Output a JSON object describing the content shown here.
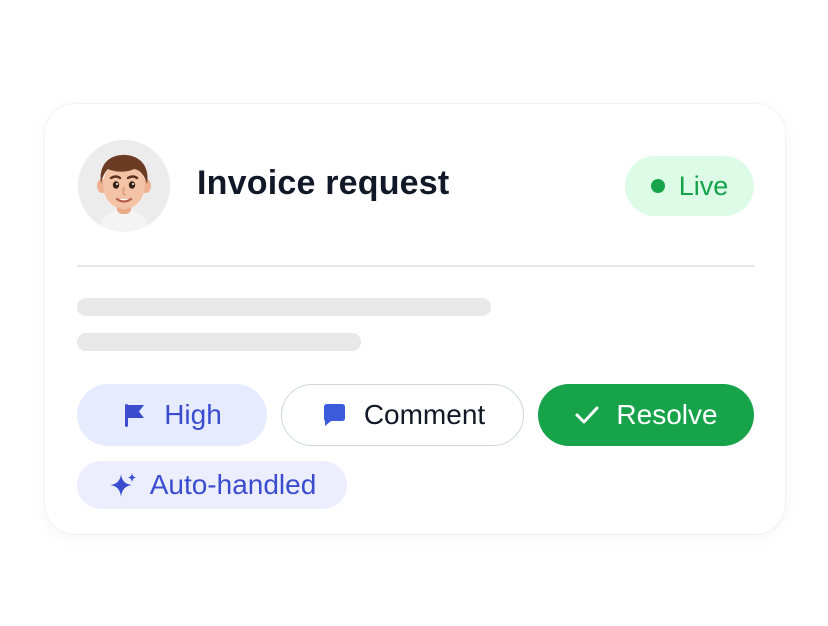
{
  "card": {
    "title": "Invoice request",
    "status_badge": {
      "label": "Live",
      "color": "#16a34a",
      "background": "#dcfce7"
    },
    "avatar": {
      "icon": "memoji-avatar"
    }
  },
  "actions": {
    "priority": {
      "label": "High",
      "icon": "flag-icon",
      "color": "#3b4ccf",
      "background": "#e6ebff"
    },
    "comment": {
      "label": "Comment",
      "icon": "comment-icon",
      "color": "#3b5bdb"
    },
    "resolve": {
      "label": "Resolve",
      "icon": "check-icon",
      "background": "#16a34a"
    }
  },
  "tags": {
    "auto": {
      "label": "Auto-handled",
      "icon": "sparkle-icon",
      "background": "#eceefe"
    }
  }
}
